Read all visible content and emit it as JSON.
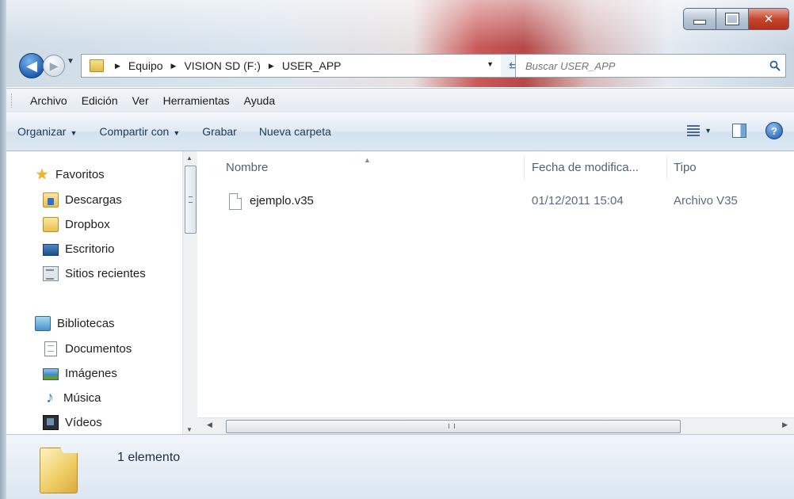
{
  "address": {
    "crumbs": [
      "Equipo",
      "VISION SD (F:)",
      "USER_APP"
    ]
  },
  "search": {
    "placeholder": "Buscar USER_APP"
  },
  "menu": [
    "Archivo",
    "Edición",
    "Ver",
    "Herramientas",
    "Ayuda"
  ],
  "commands": {
    "organize": "Organizar",
    "share": "Compartir con",
    "burn": "Grabar",
    "new_folder": "Nueva carpeta"
  },
  "nav": {
    "favorites": {
      "label": "Favoritos",
      "items": [
        "Descargas",
        "Dropbox",
        "Escritorio",
        "Sitios recientes"
      ]
    },
    "libraries": {
      "label": "Bibliotecas",
      "items": [
        "Documentos",
        "Imágenes",
        "Música",
        "Vídeos"
      ]
    }
  },
  "columns": {
    "name": "Nombre",
    "modified": "Fecha de modifica...",
    "type": "Tipo"
  },
  "files": [
    {
      "name": "ejemplo.v35",
      "modified": "01/12/2011 15:04",
      "type": "Archivo V35"
    }
  ],
  "status": {
    "count": "1 elemento"
  },
  "icons": {
    "back": "back-arrow-icon",
    "forward": "forward-arrow-icon",
    "search": "magnifier-icon",
    "help": "help-icon"
  }
}
